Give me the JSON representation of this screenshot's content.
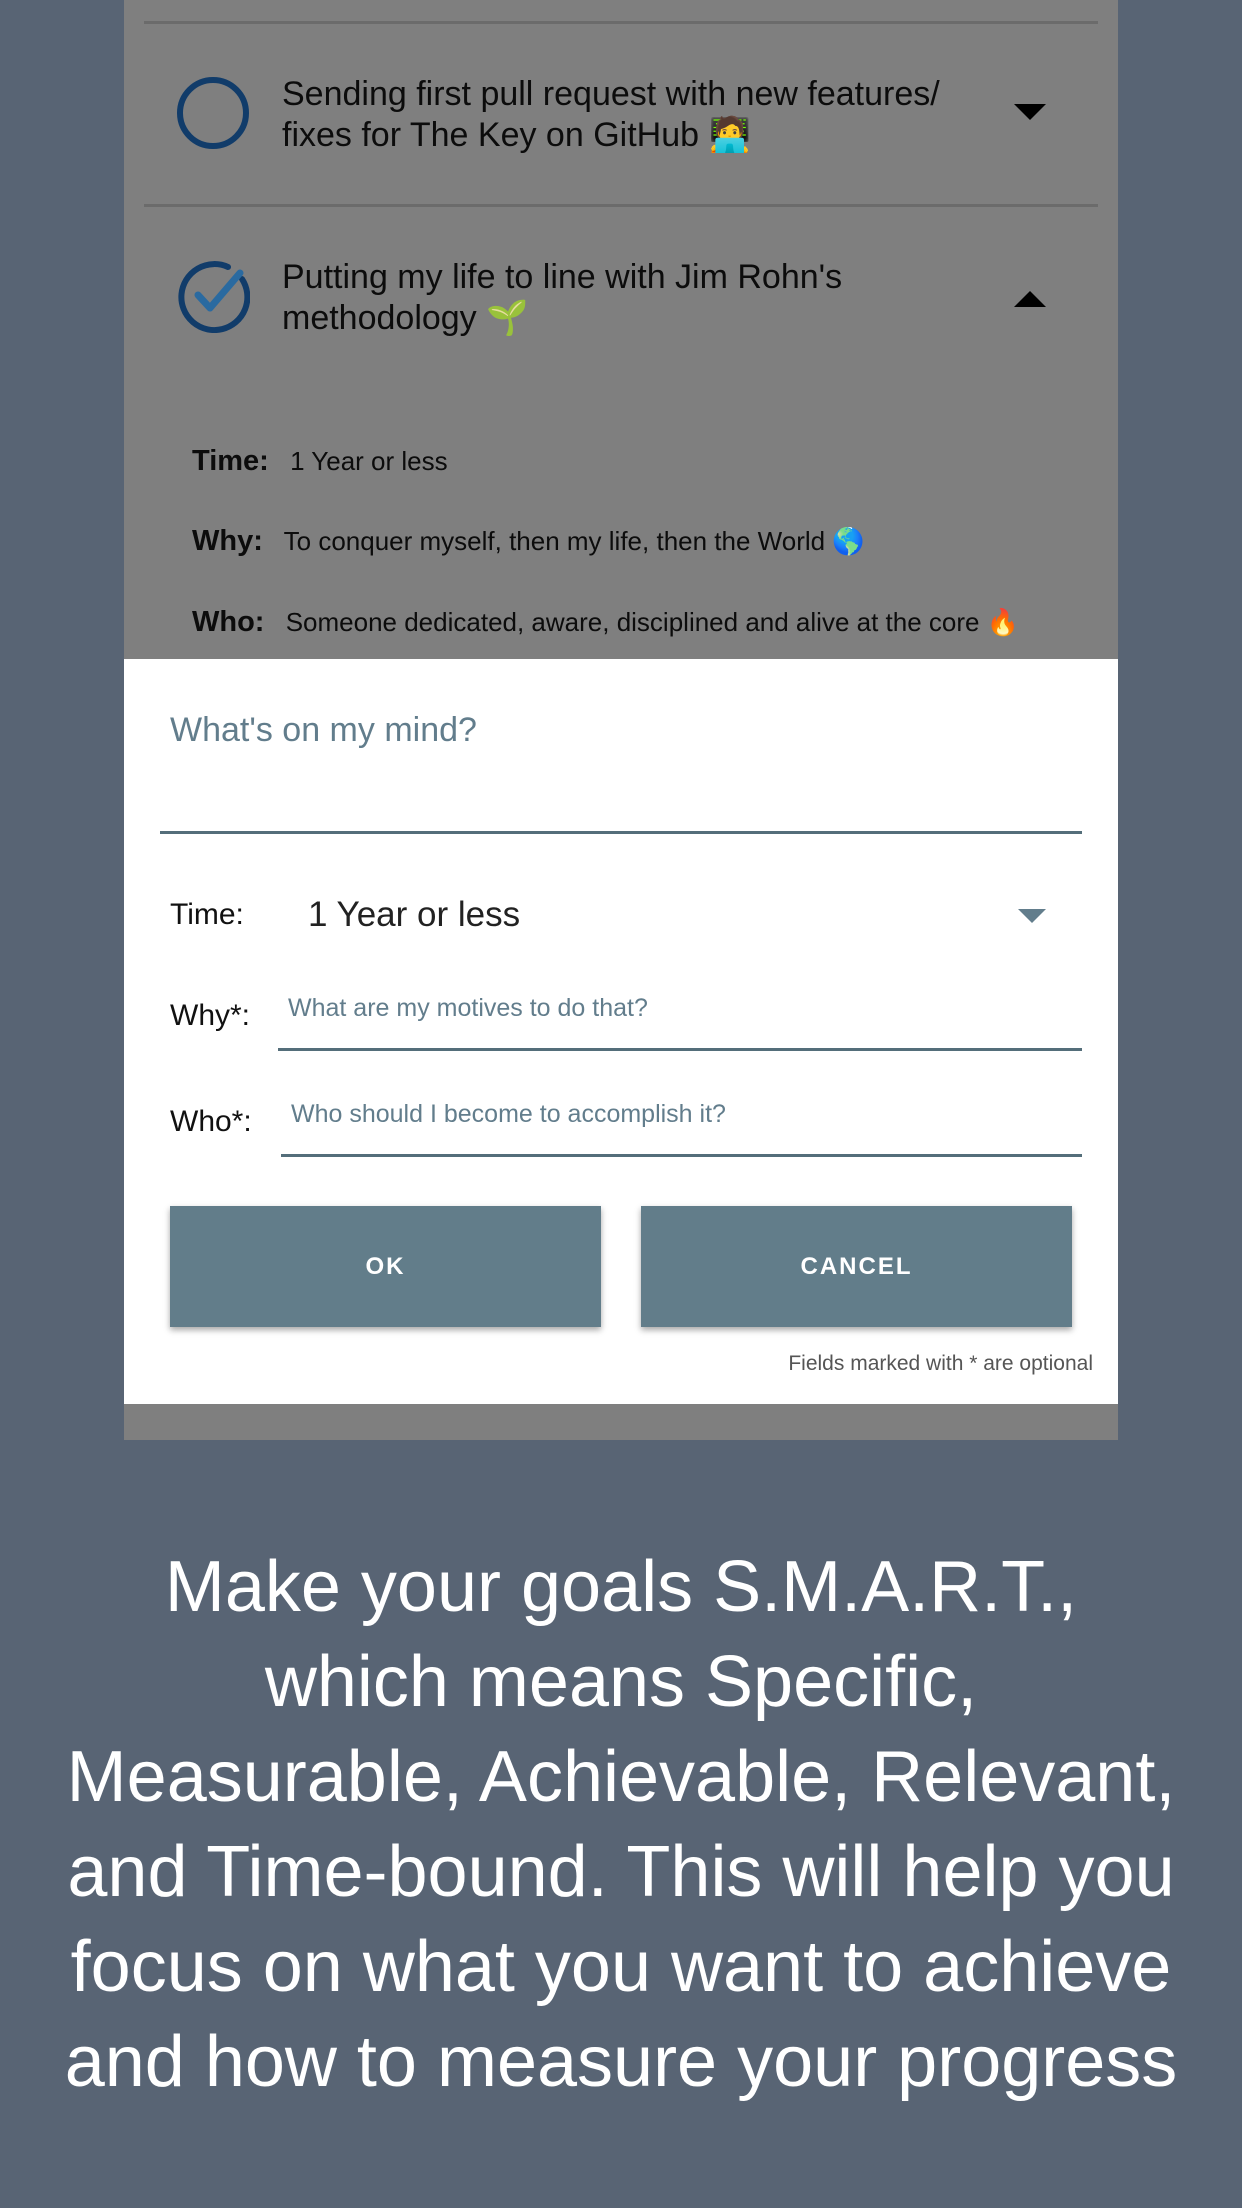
{
  "goals": [
    {
      "title_line1": "Sending first pull request with new features/",
      "title_line2": "fixes for The Key on GitHub 🧑‍💻",
      "status": "incomplete",
      "caret": "down"
    },
    {
      "title_line1": "Putting my life to line with Jim Rohn's",
      "title_line2": "methodology 🌱",
      "status": "complete",
      "caret": "up",
      "details": {
        "time_label": "Time:",
        "time_value": "1 Year or less",
        "why_label": "Why:",
        "why_value": "To conquer myself, then my life, then the World 🌎",
        "who_label": "Who:",
        "who_value": "Someone dedicated, aware, disciplined and alive at the core 🔥"
      }
    }
  ],
  "dialog": {
    "mind_placeholder": "What's on my mind?",
    "time_label": "Time:",
    "time_value": "1 Year or less",
    "why_label": "Why*:",
    "why_placeholder": "What are my motives to do that?",
    "who_label": "Who*:",
    "who_placeholder": "Who should I become to accomplish it?",
    "ok_label": "OK",
    "cancel_label": "CANCEL",
    "optional_note": "Fields marked with * are optional"
  },
  "caption": {
    "line1": "Make your goals S.M.A.R.T.,",
    "line2": "which means Specific,",
    "line3": "Measurable, Achievable, Relevant,",
    "line4": "and Time-bound. This will help you",
    "line5": "focus on what you want to achieve",
    "line6": "and how to measure your progress"
  },
  "colors": {
    "accent": "#627d8a",
    "outer_background": "#586474",
    "overlay_dim": "#7f7f7f",
    "status_icon": "#113c6a"
  }
}
